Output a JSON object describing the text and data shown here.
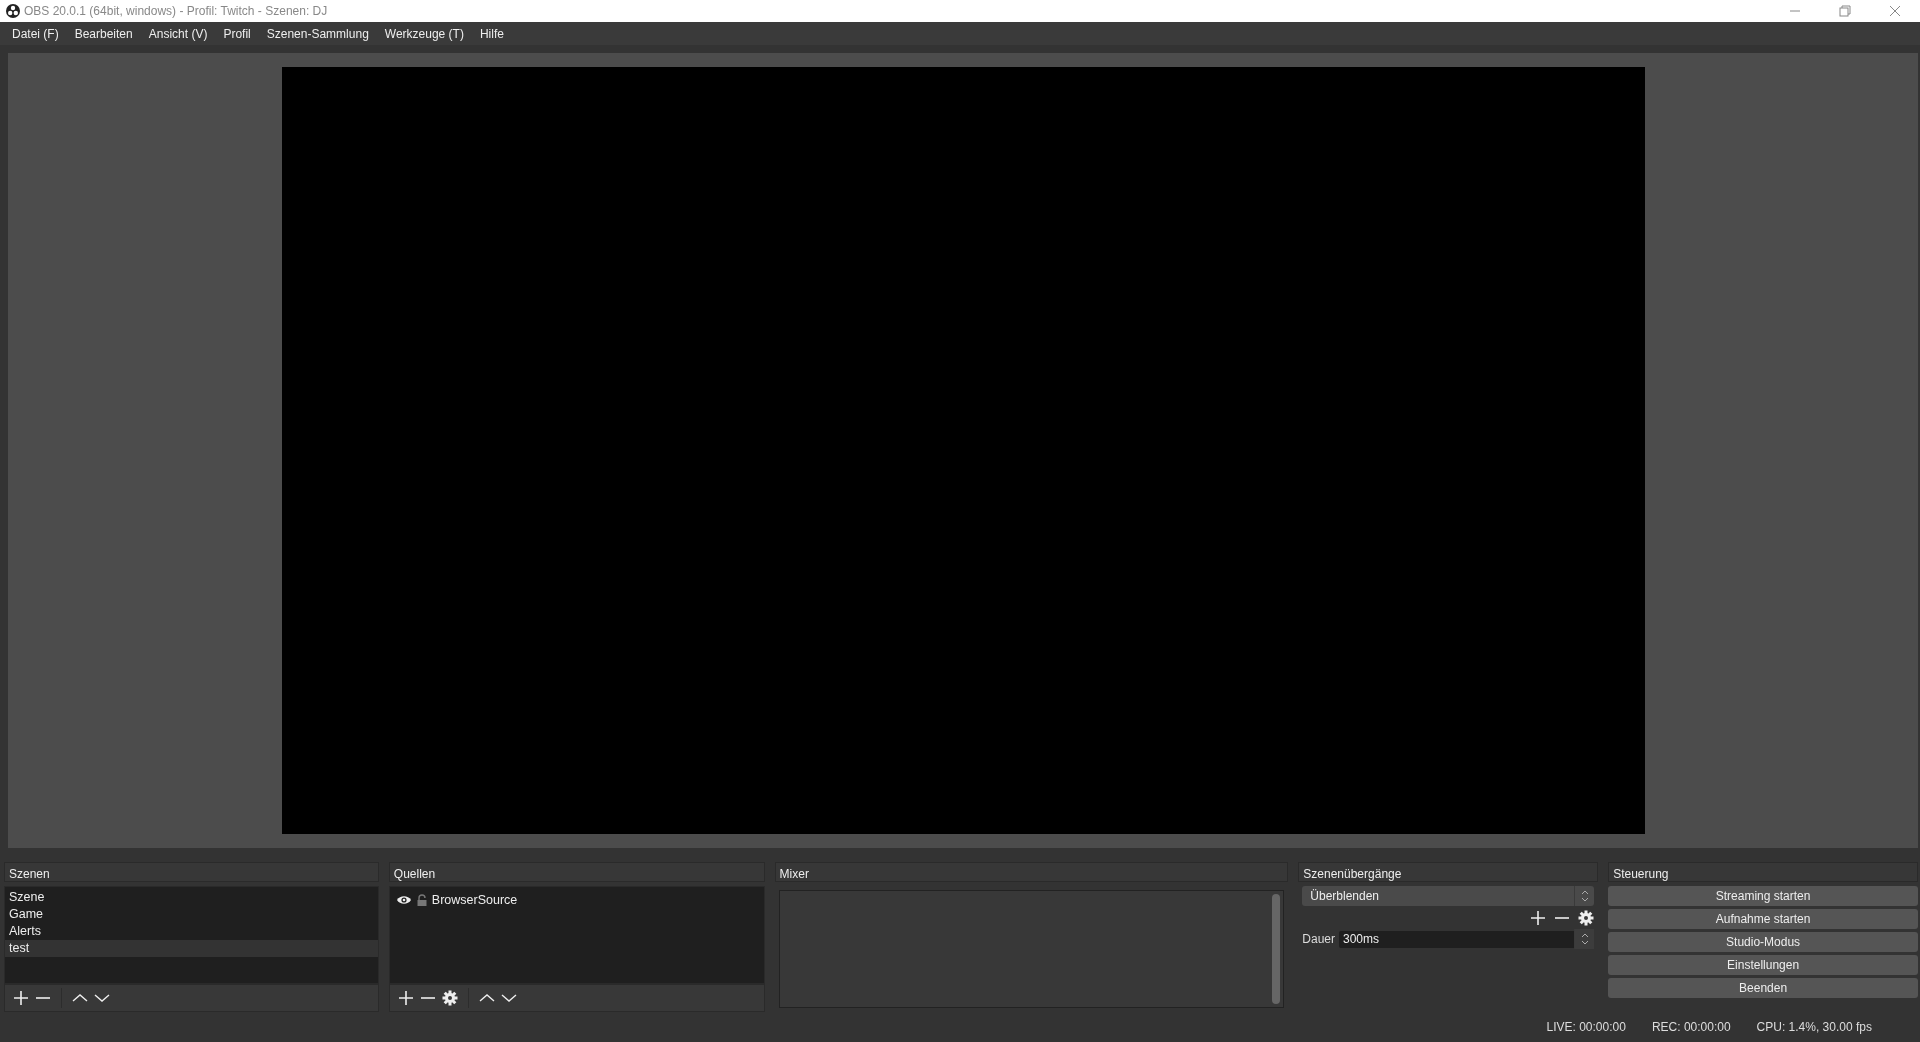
{
  "window": {
    "title": "OBS 20.0.1 (64bit, windows) - Profil: Twitch - Szenen: DJ"
  },
  "menu": [
    "Datei (F)",
    "Bearbeiten",
    "Ansicht (V)",
    "Profil",
    "Szenen-Sammlung",
    "Werkzeuge (T)",
    "Hilfe"
  ],
  "scenes": {
    "title": "Szenen",
    "items": [
      {
        "label": "Szene",
        "selected": false
      },
      {
        "label": "Game",
        "selected": false
      },
      {
        "label": "Alerts",
        "selected": false
      },
      {
        "label": "test",
        "selected": true
      }
    ]
  },
  "sources": {
    "title": "Quellen",
    "items": [
      {
        "label": "BrowserSource",
        "visible": true,
        "locked": false
      }
    ]
  },
  "mixer": {
    "title": "Mixer"
  },
  "transitions": {
    "title": "Szenenübergänge",
    "transition": "Überblenden",
    "duration_label": "Dauer",
    "duration": "300ms"
  },
  "controls": {
    "title": "Steuerung",
    "buttons": [
      "Streaming starten",
      "Aufnahme starten",
      "Studio-Modus",
      "Einstellungen",
      "Beenden"
    ]
  },
  "status_bar": [
    "LIVE: 00:00:00",
    "REC: 00:00:00",
    "CPU: 1.4%, 30.00 fps"
  ]
}
